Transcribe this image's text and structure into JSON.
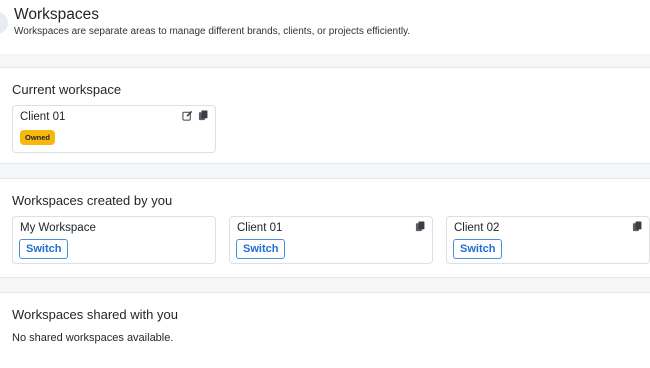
{
  "header": {
    "title": "Workspaces",
    "subtitle": "Workspaces are separate areas to manage different brands, clients, or projects efficiently."
  },
  "current_section": {
    "title": "Current workspace",
    "workspace": {
      "name": "Client 01",
      "badge": "Owned",
      "icons": [
        "edit-icon",
        "copy-icon"
      ]
    }
  },
  "created_section": {
    "title": "Workspaces created by you",
    "workspaces": [
      {
        "name": "My Workspace",
        "action": "Switch"
      },
      {
        "name": "Client 01",
        "action": "Switch",
        "icon": "copy-icon"
      },
      {
        "name": "Client 02",
        "action": "Switch",
        "icon": "copy-icon"
      }
    ]
  },
  "shared_section": {
    "title": "Workspaces shared with you",
    "empty_message": "No shared workspaces available."
  },
  "colors": {
    "badge_background": "#f6b90b",
    "accent_blue": "#1f6fd1",
    "page_background": "#f4f6f8"
  }
}
